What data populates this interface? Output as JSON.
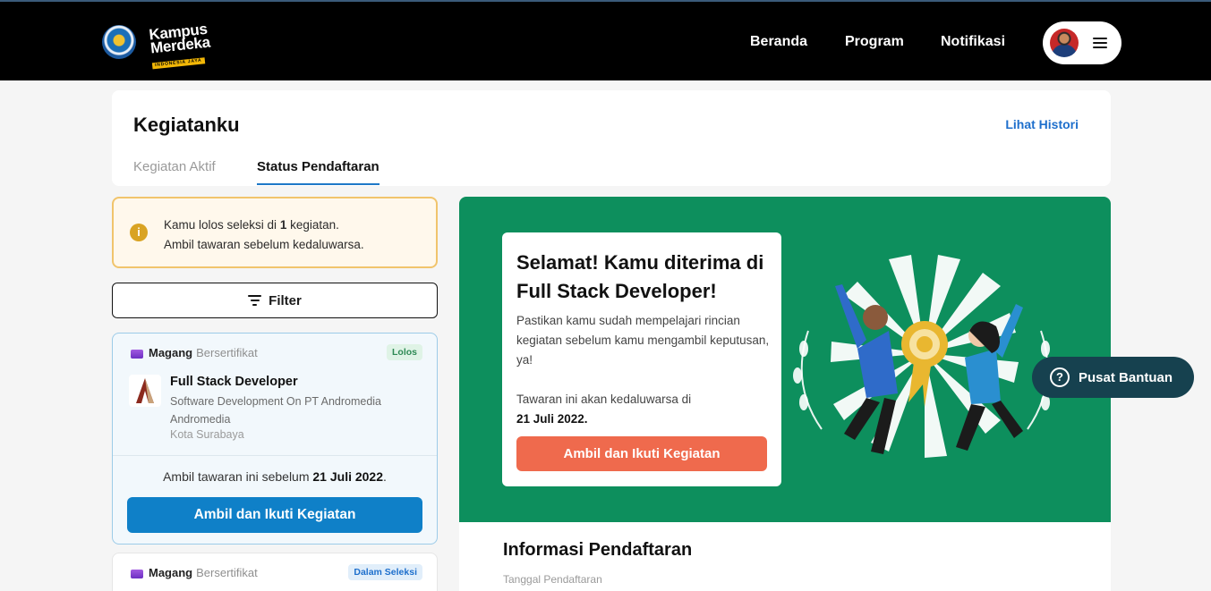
{
  "header": {
    "logo_line1": "Kampus",
    "logo_line2": "Merdeka",
    "logo_sub": "INDONESIA JAYA",
    "nav": [
      "Beranda",
      "Program",
      "Notifikasi"
    ]
  },
  "page": {
    "title": "Kegiatanku",
    "history_link": "Lihat Histori",
    "tabs": [
      {
        "label": "Kegiatan Aktif",
        "active": false
      },
      {
        "label": "Status Pendaftaran",
        "active": true
      }
    ]
  },
  "banner": {
    "icon": "i",
    "line1_prefix": "Kamu lolos seleksi di ",
    "line1_count": "1",
    "line1_suffix": " kegiatan.",
    "line2": "Ambil tawaran sebelum kedaluwarsa."
  },
  "filter_label": "Filter",
  "activities": [
    {
      "category": "Magang",
      "category_sub": "Bersertifikat",
      "status": "Lolos",
      "title": "Full Stack Developer",
      "description": "Software Development On PT Andromedia Andromedia",
      "location": "Kota Surabaya",
      "deadline_prefix": "Ambil tawaran ini sebelum ",
      "deadline_date": "21 Juli 2022",
      "deadline_suffix": ".",
      "action": "Ambil dan Ikuti Kegiatan"
    },
    {
      "category": "Magang",
      "category_sub": "Bersertifikat",
      "status": "Dalam Seleksi"
    }
  ],
  "hero": {
    "title": "Selamat! Kamu diterima di Full Stack Developer!",
    "body": "Pastikan kamu sudah mempelajari rincian kegiatan sebelum kamu mengambil keputusan, ya!",
    "expire_label": "Tawaran ini akan kedaluwarsa di",
    "expire_date": "21 Juli 2022.",
    "action": "Ambil dan Ikuti Kegiatan"
  },
  "registration_info": {
    "title": "Informasi Pendaftaran",
    "date_label": "Tanggal Pendaftaran"
  },
  "help": {
    "icon": "?",
    "label": "Pusat Bantuan"
  },
  "colors": {
    "header_bg": "#000000",
    "hero_bg": "#0d8f5d",
    "primary_blue": "#0f80c8",
    "accent_orange": "#ef6a4d",
    "help_bg": "#16414f"
  }
}
